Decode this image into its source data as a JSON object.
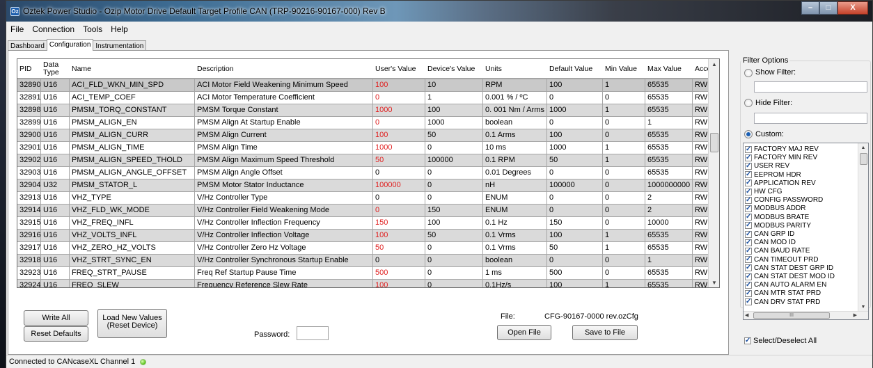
{
  "window": {
    "title": "Oztek Power Studio - Ozip Motor Drive Default Target Profile CAN (TRP-90216-90167-000) Rev B",
    "controls": {
      "minimize": "–",
      "maximize": "□",
      "close": "X"
    }
  },
  "menu": [
    "File",
    "Connection",
    "Tools",
    "Help"
  ],
  "tabs": [
    {
      "label": "Dashboard",
      "active": false
    },
    {
      "label": "Configuration",
      "active": true
    },
    {
      "label": "Instrumentation",
      "active": false
    }
  ],
  "grid": {
    "columns": [
      "PID",
      "Data Type",
      "Name",
      "Description",
      "User's Value",
      "Device's Value",
      "Units",
      "Default Value",
      "Min Value",
      "Max Value",
      "Access"
    ],
    "rows": [
      {
        "pid": "32890",
        "type": "U16",
        "name": "ACI_FLD_WKN_MIN_SPD",
        "desc": "ACI Motor Field Weakening Minimum Speed",
        "user": "100",
        "device": "10",
        "units": "RPM",
        "def": "100",
        "min": "1",
        "max": "65535",
        "access": "RW",
        "changed": true,
        "selected": true
      },
      {
        "pid": "32891",
        "type": "U16",
        "name": "ACI_TEMP_COEF",
        "desc": "ACI Motor Temperature Coefficient",
        "user": "0",
        "device": "1",
        "units": "0.001 % / ºC",
        "def": "0",
        "min": "0",
        "max": "65535",
        "access": "RW",
        "changed": true
      },
      {
        "pid": "32898",
        "type": "U16",
        "name": "PMSM_TORQ_CONSTANT",
        "desc": "PMSM Torque Constant",
        "user": "1000",
        "device": "100",
        "units": "0. 001 Nm / Arms",
        "def": "1000",
        "min": "1",
        "max": "65535",
        "access": "RW",
        "changed": true
      },
      {
        "pid": "32899",
        "type": "U16",
        "name": "PMSM_ALIGN_EN",
        "desc": "PMSM Align At Startup Enable",
        "user": "0",
        "device": "1000",
        "units": "boolean",
        "def": "0",
        "min": "0",
        "max": "1",
        "access": "RW",
        "changed": true
      },
      {
        "pid": "32900",
        "type": "U16",
        "name": "PMSM_ALIGN_CURR",
        "desc": "PMSM Align Current",
        "user": "100",
        "device": "50",
        "units": "0.1 Arms",
        "def": "100",
        "min": "0",
        "max": "65535",
        "access": "RW",
        "changed": true
      },
      {
        "pid": "32901",
        "type": "U16",
        "name": "PMSM_ALIGN_TIME",
        "desc": "PMSM Align Time",
        "user": "1000",
        "device": "0",
        "units": "10 ms",
        "def": "1000",
        "min": "1",
        "max": "65535",
        "access": "RW",
        "changed": true
      },
      {
        "pid": "32902",
        "type": "U16",
        "name": "PMSM_ALIGN_SPEED_THOLD",
        "desc": "PMSM Align Maximum Speed Threshold",
        "user": "50",
        "device": "100000",
        "units": "0.1 RPM",
        "def": "50",
        "min": "1",
        "max": "65535",
        "access": "RW",
        "changed": true
      },
      {
        "pid": "32903",
        "type": "U16",
        "name": "PMSM_ALIGN_ANGLE_OFFSET",
        "desc": "PMSM Align Angle Offset",
        "user": "0",
        "device": "0",
        "units": "0.01 Degrees",
        "def": "0",
        "min": "0",
        "max": "65535",
        "access": "RW",
        "changed": false
      },
      {
        "pid": "32904",
        "type": "U32",
        "name": "PMSM_STATOR_L",
        "desc": "PMSM Motor Stator Inductance",
        "user": "100000",
        "device": "0",
        "units": "nH",
        "def": "100000",
        "min": "0",
        "max": "1000000000",
        "access": "RW",
        "changed": true
      },
      {
        "pid": "32913",
        "type": "U16",
        "name": "VHZ_TYPE",
        "desc": "V/Hz Controller Type",
        "user": "0",
        "device": "0",
        "units": "ENUM",
        "def": "0",
        "min": "0",
        "max": "2",
        "access": "RW",
        "changed": false
      },
      {
        "pid": "32914",
        "type": "U16",
        "name": "VHZ_FLD_WK_MODE",
        "desc": "V/Hz Controller Field Weakening Mode",
        "user": "0",
        "device": "150",
        "units": "ENUM",
        "def": "0",
        "min": "0",
        "max": "2",
        "access": "RW",
        "changed": true
      },
      {
        "pid": "32915",
        "type": "U16",
        "name": "VHZ_FREQ_INFL",
        "desc": "V/Hz Controller Inflection Frequency",
        "user": "150",
        "device": "100",
        "units": "0.1 Hz",
        "def": "150",
        "min": "0",
        "max": "10000",
        "access": "RW",
        "changed": true
      },
      {
        "pid": "32916",
        "type": "U16",
        "name": "VHZ_VOLTS_INFL",
        "desc": "V/Hz Controller Inflection Voltage",
        "user": "100",
        "device": "50",
        "units": "0.1 Vrms",
        "def": "100",
        "min": "1",
        "max": "65535",
        "access": "RW",
        "changed": true
      },
      {
        "pid": "32917",
        "type": "U16",
        "name": "VHZ_ZERO_HZ_VOLTS",
        "desc": "V/Hz Controller Zero Hz Voltage",
        "user": "50",
        "device": "0",
        "units": "0.1 Vrms",
        "def": "50",
        "min": "1",
        "max": "65535",
        "access": "RW",
        "changed": true
      },
      {
        "pid": "32918",
        "type": "U16",
        "name": "VHZ_STRT_SYNC_EN",
        "desc": "V/Hz Controller Synchronous Startup Enable",
        "user": "0",
        "device": "0",
        "units": "boolean",
        "def": "0",
        "min": "0",
        "max": "1",
        "access": "RW",
        "changed": false
      },
      {
        "pid": "32923",
        "type": "U16",
        "name": "FREQ_STRT_PAUSE",
        "desc": "Freq Ref Startup Pause Time",
        "user": "500",
        "device": "0",
        "units": "1 ms",
        "def": "500",
        "min": "0",
        "max": "65535",
        "access": "RW",
        "changed": true
      },
      {
        "pid": "32924",
        "type": "U16",
        "name": "FREQ_SLEW",
        "desc": "Frequency Reference Slew Rate",
        "user": "100",
        "device": "0",
        "units": "0.1Hz/s",
        "def": "100",
        "min": "1",
        "max": "65535",
        "access": "RW",
        "changed": true
      }
    ]
  },
  "actions": {
    "write_all": "Write All",
    "reset_defaults": "Reset Defaults",
    "load_new_values": [
      "Load New Values",
      "(Reset Device)"
    ],
    "password_label": "Password:",
    "password_value": "",
    "file_label": "File:",
    "file_name": "CFG-90167-0000  rev.ozCfg",
    "open_file": "Open File",
    "save_to_file": "Save to File"
  },
  "filter": {
    "title": "Filter Options",
    "show_filter": {
      "label": "Show Filter:",
      "value": "",
      "selected": false
    },
    "hide_filter": {
      "label": "Hide Filter:",
      "value": "",
      "selected": false
    },
    "custom": {
      "label": "Custom:",
      "selected": true
    },
    "items": [
      "FACTORY MAJ REV",
      "FACTORY MIN REV",
      "USER REV",
      "EEPROM HDR",
      "APPLICATION REV",
      "HW CFG",
      "CONFIG PASSWORD",
      "MODBUS ADDR",
      "MODBUS BRATE",
      "MODBUS PARITY",
      "CAN GRP ID",
      "CAN MOD ID",
      "CAN BAUD RATE",
      "CAN TIMEOUT PRD",
      "CAN STAT DEST GRP ID",
      "CAN STAT DEST MOD ID",
      "CAN AUTO ALARM EN",
      "CAN MTR STAT PRD",
      "CAN DRV STAT PRD"
    ],
    "select_all": {
      "label": "Select/Deselect All",
      "checked": true
    },
    "list_hscroll_grip": "III"
  },
  "status": {
    "text": "Connected to CANcaseXL Channel 1"
  },
  "colors": {
    "changed_value": "#e02020",
    "status_led": "#59c21b"
  }
}
